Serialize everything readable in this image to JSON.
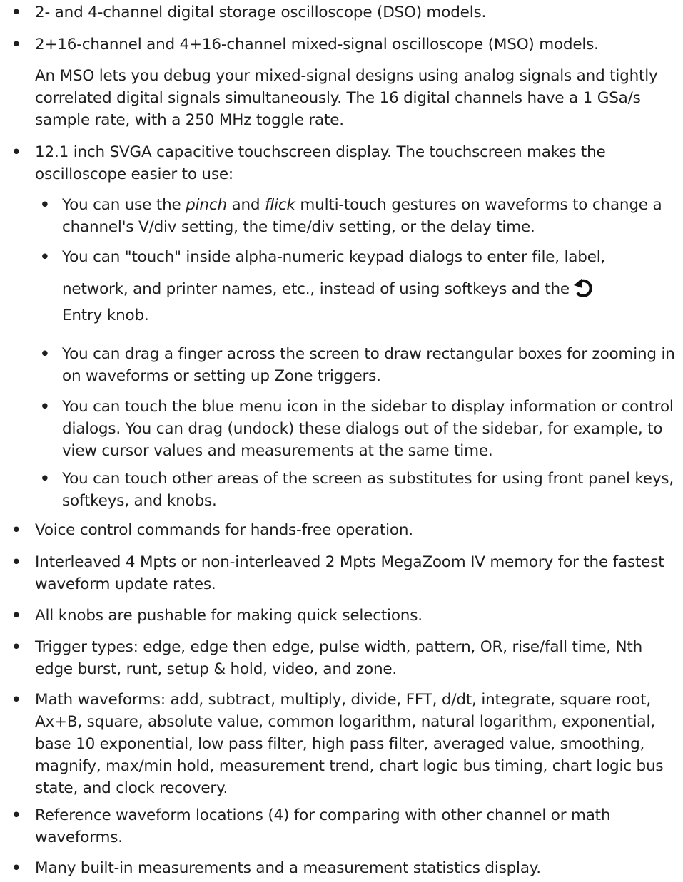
{
  "bullet_char": "•",
  "items": [
    {
      "text": "2- and 4-channel digital storage oscilloscope (DSO) models."
    },
    {
      "text": "2+16-channel and 4+16-channel mixed-signal oscilloscope (MSO) models."
    },
    {
      "text": "An MSO lets you debug your mixed-signal designs using analog signals and tightly correlated digital signals simultaneously. The 16 digital channels have a 1 GSa/s sample rate, with a 250 MHz toggle rate."
    },
    {
      "text": "12.1 inch SVGA capacitive touchscreen display. The touchscreen makes the oscilloscope easier to use:"
    },
    {
      "pre": "You can use the ",
      "em1": "pinch",
      "mid": " and ",
      "em2": "flick",
      "post": " multi-touch gestures on waveforms to change a channel's V/div setting, the time/div setting, or the delay time."
    },
    {
      "line1": "You can \"touch\" inside alpha-numeric keypad dialogs to enter file, label,",
      "line2": "network, and printer names, etc., instead of using softkeys and the",
      "line3": "Entry knob.",
      "icon": "entry-knob-icon"
    },
    {
      "text": "You can drag a finger across the screen to draw rectangular boxes for zooming in on waveforms or setting up Zone triggers."
    },
    {
      "text": "You can touch the blue menu icon in the sidebar to display information or control dialogs. You can drag (undock) these dialogs out of the sidebar, for example, to view cursor values and measurements at the same time."
    },
    {
      "text": "You can touch other areas of the screen as substitutes for using front panel keys, softkeys, and knobs."
    },
    {
      "text": "Voice control commands for hands-free operation."
    },
    {
      "text": "Interleaved 4 Mpts or non-interleaved 2 Mpts MegaZoom IV memory for the fastest waveform update rates."
    },
    {
      "text": "All knobs are pushable for making quick selections."
    },
    {
      "text": "Trigger types: edge, edge then edge, pulse width, pattern, OR, rise/fall time, Nth edge burst, runt, setup & hold, video, and zone."
    },
    {
      "text": "Math waveforms: add, subtract, multiply, divide, FFT, d/dt, integrate, square root, Ax+B, square, absolute value, common logarithm, natural logarithm, exponential, base 10 exponential, low pass filter, high pass filter, averaged value, smoothing, magnify, max/min hold, measurement trend, chart logic bus timing, chart logic bus state, and clock recovery."
    },
    {
      "text": "Reference waveform locations (4) for comparing with other channel or math waveforms."
    },
    {
      "text": "Many built-in measurements and a measurement statistics display."
    }
  ]
}
